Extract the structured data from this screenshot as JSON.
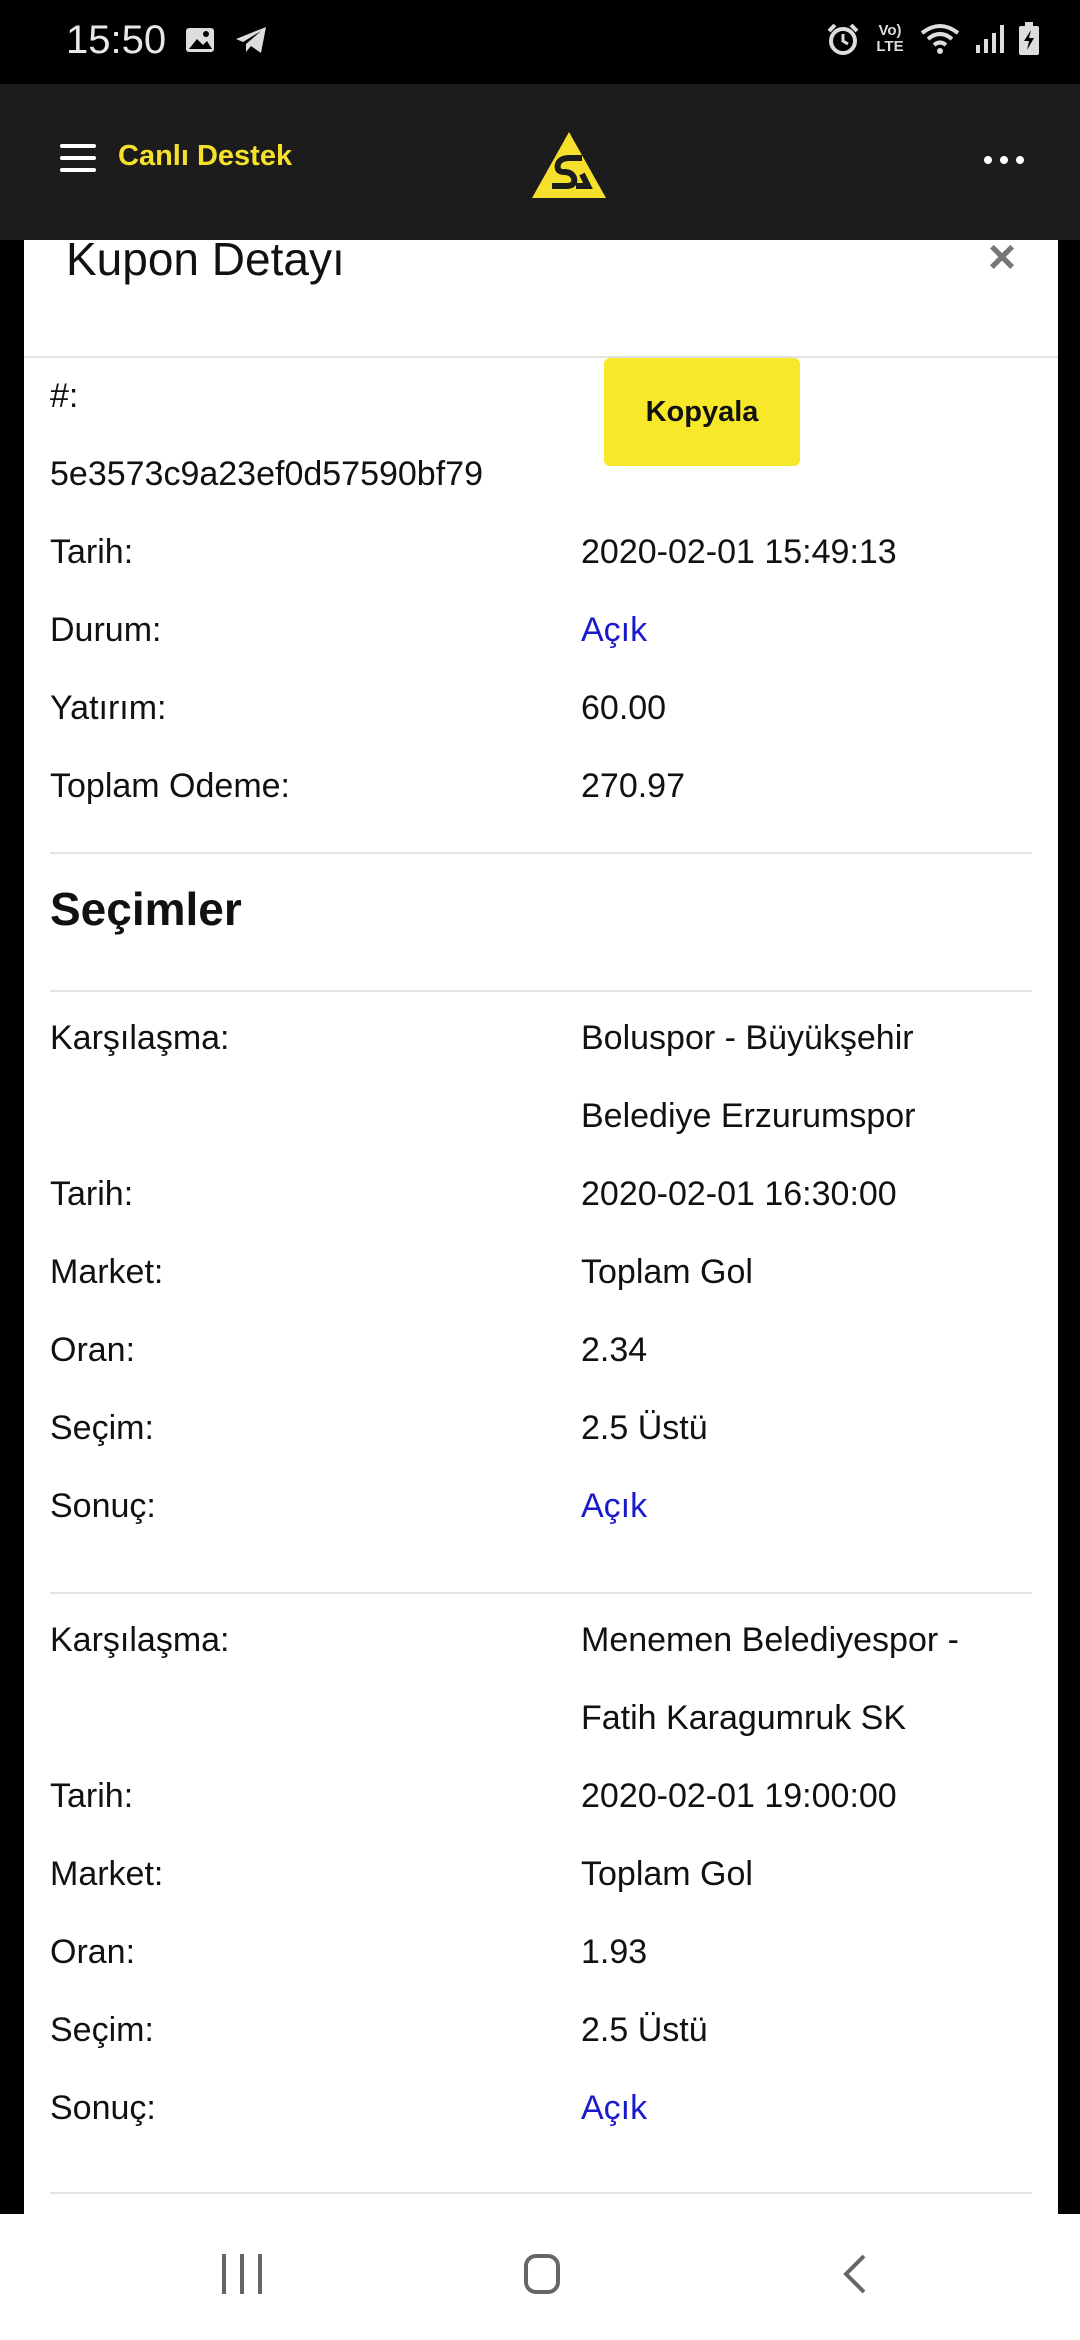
{
  "status_bar": {
    "time": "15:50",
    "icons_left": [
      "image-icon",
      "telegram-icon"
    ],
    "icons_right": [
      "alarm-icon",
      "volte-icon",
      "wifi-icon",
      "signal-icon",
      "battery-icon"
    ],
    "volte_text": "Vo) LTE"
  },
  "app_bar": {
    "menu_icon": "hamburger-icon",
    "live_support_label": "Canlı Destek",
    "logo": "brand-logo-icon",
    "more_icon": "more-dots-icon"
  },
  "modal": {
    "title": "Kupon Detayı",
    "close_label": "×",
    "hash_label": "#:",
    "hash_value": "5e3573c9a23ef0d57590bf79",
    "copy_button": "Kopyala",
    "summary": [
      {
        "label": "Tarih:",
        "value": "2020-02-01 15:49:13"
      },
      {
        "label": "Durum:",
        "value": "Açık"
      },
      {
        "label": "Yatırım:",
        "value": "60.00"
      },
      {
        "label": "Toplam Odeme:",
        "value": "270.97"
      }
    ],
    "selections_title": "Seçimler",
    "selections": [
      {
        "match_label": "Karşılaşma:",
        "match_line1": "Boluspor - Büyükşehir",
        "match_line2": "Belediye Erzurumspor",
        "rows": [
          {
            "label": "Tarih:",
            "value": "2020-02-01 16:30:00"
          },
          {
            "label": "Market:",
            "value": "Toplam Gol"
          },
          {
            "label": "Oran:",
            "value": "2.34"
          },
          {
            "label": "Seçim:",
            "value": "2.5 Üstü"
          },
          {
            "label": "Sonuç:",
            "value": "Açık"
          }
        ]
      },
      {
        "match_label": "Karşılaşma:",
        "match_line1": "Menemen Belediyespor -",
        "match_line2": "Fatih Karagumruk SK",
        "rows": [
          {
            "label": "Tarih:",
            "value": "2020-02-01 19:00:00"
          },
          {
            "label": "Market:",
            "value": "Toplam Gol"
          },
          {
            "label": "Oran:",
            "value": "1.93"
          },
          {
            "label": "Seçim:",
            "value": "2.5 Üstü"
          },
          {
            "label": "Sonuç:",
            "value": "Açık"
          }
        ]
      }
    ]
  },
  "colors": {
    "accent_yellow": "#f8e82a",
    "open_status_blue": "#1a1acc",
    "header_bg": "#1c1c1c"
  },
  "nav_bar": {
    "icons": [
      "recents-icon",
      "home-icon",
      "back-icon"
    ]
  }
}
